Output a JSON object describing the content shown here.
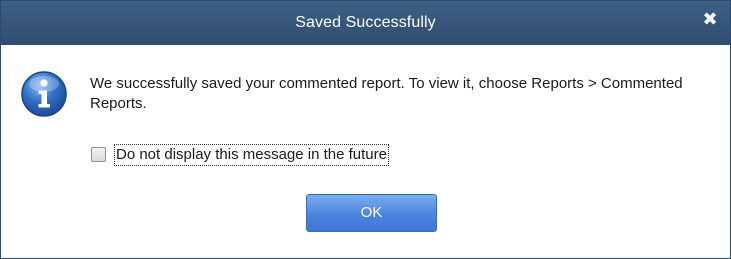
{
  "dialog": {
    "title": "Saved Successfully",
    "close_glyph": "✖",
    "message": "We successfully saved your commented report. To view it, choose Reports > Commented Reports.",
    "checkbox": {
      "label": "Do not display this message in the future",
      "checked": false
    },
    "ok_label": "OK"
  },
  "icons": {
    "info": "info-icon",
    "close": "close-icon"
  },
  "colors": {
    "titlebar": "#34537a",
    "ok_button": "#4a84dd"
  }
}
